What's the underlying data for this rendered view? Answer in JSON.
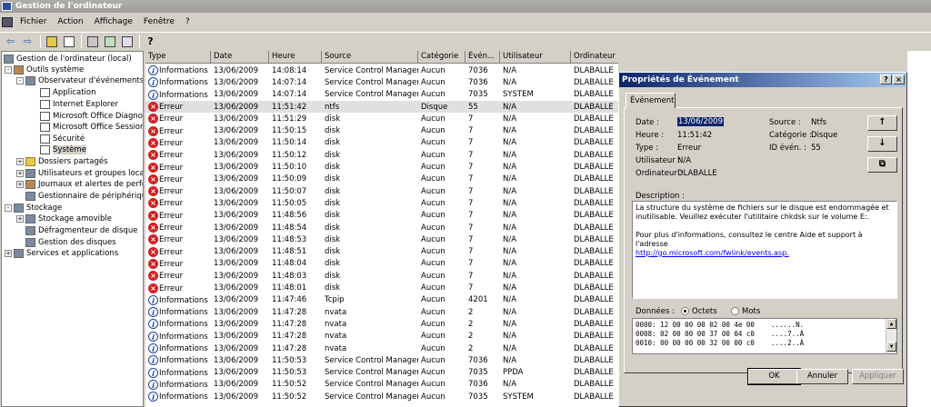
{
  "window": {
    "title": "Gestion de l'ordinateur"
  },
  "menu": {
    "items": [
      "Fichier",
      "Action",
      "Affichage",
      "Fenêtre",
      "?"
    ]
  },
  "toolbar": {
    "icons": [
      "back-arrow-icon",
      "forward-arrow-icon",
      "up-folder-icon",
      "show-hide-tree-icon",
      "properties-icon",
      "refresh-icon",
      "export-list-icon",
      "help-icon"
    ]
  },
  "tree": {
    "nodes": [
      {
        "label": "Gestion de l'ordinateur (local)",
        "icon": "computer-icon",
        "exp": ""
      },
      {
        "label": "Outils système",
        "icon": "tools-icon",
        "exp": "-"
      },
      {
        "label": "Observateur d'événements",
        "icon": "event-viewer-icon",
        "exp": "-"
      },
      {
        "label": "Application",
        "icon": "log-icon",
        "exp": ""
      },
      {
        "label": "Internet Explorer",
        "icon": "log-icon",
        "exp": ""
      },
      {
        "label": "Microsoft Office Diagnost",
        "icon": "log-icon",
        "exp": ""
      },
      {
        "label": "Microsoft Office Sessions",
        "icon": "log-icon",
        "exp": ""
      },
      {
        "label": "Sécurité",
        "icon": "log-icon",
        "exp": ""
      },
      {
        "label": "Système",
        "icon": "log-icon",
        "exp": ""
      },
      {
        "label": "Dossiers partagés",
        "icon": "folder-icon",
        "exp": "+"
      },
      {
        "label": "Utilisateurs et groupes locau",
        "icon": "users-icon",
        "exp": "+"
      },
      {
        "label": "Journaux et alertes de perfo",
        "icon": "perf-icon",
        "exp": "+"
      },
      {
        "label": "Gestionnaire de périphérique",
        "icon": "device-manager-icon",
        "exp": ""
      },
      {
        "label": "Stockage",
        "icon": "storage-icon",
        "exp": "-"
      },
      {
        "label": "Stockage amovible",
        "icon": "removable-storage-icon",
        "exp": "+"
      },
      {
        "label": "Défragmenteur de disque",
        "icon": "defrag-icon",
        "exp": ""
      },
      {
        "label": "Gestion des disques",
        "icon": "disk-management-icon",
        "exp": ""
      },
      {
        "label": "Services et applications",
        "icon": "services-icon",
        "exp": "+"
      }
    ]
  },
  "list": {
    "columns": [
      "Type",
      "Date",
      "Heure",
      "Source",
      "Catégorie",
      "Évén...",
      "Utilisateur",
      "Ordinateur"
    ],
    "rows": [
      [
        "Informations",
        "13/06/2009",
        "14:08:14",
        "Service Control Manager",
        "Aucun",
        "7036",
        "N/A",
        "DLABALLE"
      ],
      [
        "Informations",
        "13/06/2009",
        "14:07:14",
        "Service Control Manager",
        "Aucun",
        "7036",
        "N/A",
        "DLABALLE"
      ],
      [
        "Informations",
        "13/06/2009",
        "14:07:14",
        "Service Control Manager",
        "Aucun",
        "7035",
        "SYSTEM",
        "DLABALLE"
      ],
      [
        "Erreur",
        "13/06/2009",
        "11:51:42",
        "ntfs",
        "Disque",
        "55",
        "N/A",
        "DLABALLE"
      ],
      [
        "Erreur",
        "13/06/2009",
        "11:51:29",
        "disk",
        "Aucun",
        "7",
        "N/A",
        "DLABALLE"
      ],
      [
        "Erreur",
        "13/06/2009",
        "11:50:15",
        "disk",
        "Aucun",
        "7",
        "N/A",
        "DLABALLE"
      ],
      [
        "Erreur",
        "13/06/2009",
        "11:50:14",
        "disk",
        "Aucun",
        "7",
        "N/A",
        "DLABALLE"
      ],
      [
        "Erreur",
        "13/06/2009",
        "11:50:12",
        "disk",
        "Aucun",
        "7",
        "N/A",
        "DLABALLE"
      ],
      [
        "Erreur",
        "13/06/2009",
        "11:50:10",
        "disk",
        "Aucun",
        "7",
        "N/A",
        "DLABALLE"
      ],
      [
        "Erreur",
        "13/06/2009",
        "11:50:09",
        "disk",
        "Aucun",
        "7",
        "N/A",
        "DLABALLE"
      ],
      [
        "Erreur",
        "13/06/2009",
        "11:50:07",
        "disk",
        "Aucun",
        "7",
        "N/A",
        "DLABALLE"
      ],
      [
        "Erreur",
        "13/06/2009",
        "11:50:05",
        "disk",
        "Aucun",
        "7",
        "N/A",
        "DLABALLE"
      ],
      [
        "Erreur",
        "13/06/2009",
        "11:48:56",
        "disk",
        "Aucun",
        "7",
        "N/A",
        "DLABALLE"
      ],
      [
        "Erreur",
        "13/06/2009",
        "11:48:54",
        "disk",
        "Aucun",
        "7",
        "N/A",
        "DLABALLE"
      ],
      [
        "Erreur",
        "13/06/2009",
        "11:48:53",
        "disk",
        "Aucun",
        "7",
        "N/A",
        "DLABALLE"
      ],
      [
        "Erreur",
        "13/06/2009",
        "11:48:51",
        "disk",
        "Aucun",
        "7",
        "N/A",
        "DLABALLE"
      ],
      [
        "Erreur",
        "13/06/2009",
        "11:48:04",
        "disk",
        "Aucun",
        "7",
        "N/A",
        "DLABALLE"
      ],
      [
        "Erreur",
        "13/06/2009",
        "11:48:03",
        "disk",
        "Aucun",
        "7",
        "N/A",
        "DLABALLE"
      ],
      [
        "Erreur",
        "13/06/2009",
        "11:48:01",
        "disk",
        "Aucun",
        "7",
        "N/A",
        "DLABALLE"
      ],
      [
        "Informations",
        "13/06/2009",
        "11:47:46",
        "Tcpip",
        "Aucun",
        "4201",
        "N/A",
        "DLABALLE"
      ],
      [
        "Informations",
        "13/06/2009",
        "11:47:28",
        "nvata",
        "Aucun",
        "2",
        "N/A",
        "DLABALLE"
      ],
      [
        "Informations",
        "13/06/2009",
        "11:47:28",
        "nvata",
        "Aucun",
        "2",
        "N/A",
        "DLABALLE"
      ],
      [
        "Informations",
        "13/06/2009",
        "11:47:28",
        "nvata",
        "Aucun",
        "2",
        "N/A",
        "DLABALLE"
      ],
      [
        "Informations",
        "13/06/2009",
        "11:47:28",
        "nvata",
        "Aucun",
        "2",
        "N/A",
        "DLABALLE"
      ],
      [
        "Informations",
        "13/06/2009",
        "11:50:53",
        "Service Control Manager",
        "Aucun",
        "7036",
        "N/A",
        "DLABALLE"
      ],
      [
        "Informations",
        "13/06/2009",
        "11:50:53",
        "Service Control Manager",
        "Aucun",
        "7035",
        "PPDA",
        "DLABALLE"
      ],
      [
        "Informations",
        "13/06/2009",
        "11:50:52",
        "Service Control Manager",
        "Aucun",
        "7036",
        "N/A",
        "DLABALLE"
      ],
      [
        "Informations",
        "13/06/2009",
        "11:50:52",
        "Service Control Manager",
        "Aucun",
        "7035",
        "SYSTEM",
        "DLABALLE"
      ]
    ]
  },
  "dialog": {
    "title": "Propriétés de Événement",
    "tab": "Événement",
    "date_label": "Date :",
    "date_value": "13/06/2009",
    "time_label": "Heure :",
    "time_value": "11:51:42",
    "type_label": "Type :",
    "type_value": "Erreur",
    "user_label": "Utilisateur :",
    "user_value": "N/A",
    "computer_label": "Ordinateur :",
    "computer_value": "DLABALLE",
    "source_label": "Source :",
    "source_value": "Ntfs",
    "category_label": "Catégorie :",
    "category_value": "Disque",
    "eventid_label": "ID évén. :",
    "eventid_value": "55",
    "description_label": "Description :",
    "description_text": "La structure du système de fichiers sur le disque est endommagée et inutilisable. Veuillez exécuter l'utilitaire chkdsk sur le volume E:.",
    "description_more": "Pour plus d'informations, consultez le centre Aide et support à l'adresse",
    "description_link": "http://go.microsoft.com/fwlink/events.asp.",
    "data_label": "Données :",
    "radio_bytes": "Octets",
    "radio_words": "Mots",
    "data_lines": [
      "0000: 12 00 00 00 02 00 4e 00    ......N.",
      "0008: 02 00 00 00 37 00 04 c0    ....7..À",
      "0010: 00 00 00 00 32 00 00 c0    ....2..À"
    ],
    "ok": "OK",
    "cancel": "Annuler",
    "apply": "Appliquer"
  }
}
